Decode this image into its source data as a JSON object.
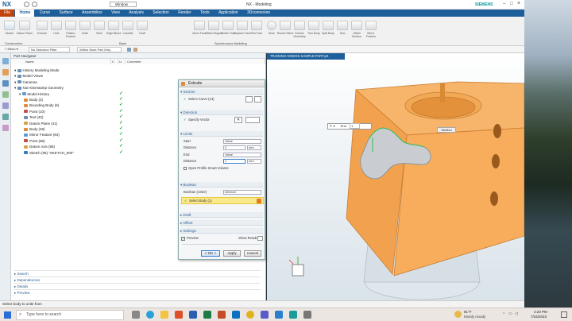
{
  "app": {
    "logo": "NX",
    "window_menu": "Window",
    "title": "NX - Modeling",
    "brand": "SIEMENS",
    "search_placeholder": "Search"
  },
  "ribbon": {
    "tabs": [
      "File",
      "Home",
      "Curve",
      "Surface",
      "Assemblies",
      "View",
      "Analysis",
      "Selection",
      "Render",
      "Tools",
      "Application",
      "3Dconnexion"
    ],
    "active_tab": "Home",
    "groups": {
      "construction": "Construction",
      "base": "Base",
      "synchronous": "Synchronous Modeling"
    },
    "more_label": "More",
    "buttons": [
      "Sketch",
      "Datum Plane",
      "Extrude",
      "Hole",
      "Pattern Feature",
      "Unite",
      "Shell",
      "Edge Blend",
      "Chamfer",
      "Draft",
      "Move Face",
      "Offset Region",
      "Delete Face",
      "Replace Face",
      "Pull Face",
      "Resize Blend",
      "Extract Geometry",
      "Trim Body",
      "Split Body",
      "Sew",
      "Offset Surface",
      "Mirror Feature"
    ]
  },
  "toolbar": {
    "menu_label": "Menu",
    "filter_value": "No Selection Filter",
    "scope_value": "Within Work Part Only"
  },
  "navigator": {
    "title": "Part Navigator",
    "columns": [
      "Name",
      "C.",
      "U.",
      "Comment"
    ],
    "rows": [
      {
        "label": "History Modeling Mode",
        "level": 0,
        "color": "#6a8fb5",
        "check": false
      },
      {
        "label": "Model Views",
        "level": 0,
        "color": "#6a8fb5",
        "check": false
      },
      {
        "label": "Cameras",
        "level": 0,
        "color": "#6a8fb5",
        "check": false
      },
      {
        "label": "Non-timestamp Geometry",
        "level": 0,
        "color": "#6a8fb5",
        "check": false
      },
      {
        "label": "Model History",
        "level": 1,
        "color": "#5c9bd5",
        "check": true
      },
      {
        "label": "Body (2)",
        "level": 2,
        "color": "#e08a3c",
        "check": true
      },
      {
        "label": "Bounding Body (6)",
        "level": 2,
        "color": "#e08a3c",
        "check": true
      },
      {
        "label": "Point (10)",
        "level": 2,
        "color": "#c24d4d",
        "check": true
      },
      {
        "label": "Text (40)",
        "level": 2,
        "color": "#6a8fb5",
        "check": true
      },
      {
        "label": "Datum Plane (41)",
        "level": 2,
        "color": "#d9a24a",
        "check": true
      },
      {
        "label": "Body (48)",
        "level": 2,
        "color": "#e08a3c",
        "check": true
      },
      {
        "label": "Mirror Feature (84)",
        "level": 2,
        "color": "#5c9bd5",
        "check": true
      },
      {
        "label": "Point (85)",
        "level": 2,
        "color": "#c24d4d",
        "check": true
      },
      {
        "label": "Datum Axis (86)",
        "level": 2,
        "color": "#d9a24a",
        "check": true
      },
      {
        "label": "Sketch (99) \"SKETCH_000\"",
        "level": 2,
        "color": "#3d7ab8",
        "check": true
      }
    ],
    "sections": [
      "Search",
      "Dependencies",
      "Details",
      "Preview"
    ]
  },
  "graphics": {
    "tab_label": "TRAINING-VIDEOS-SAMPLE-PART.prt",
    "onscreen_label": "Section",
    "end_label": "End",
    "end_value": "1"
  },
  "dialog": {
    "title": "Extrude",
    "sections": {
      "section": "Section",
      "direction": "Direction",
      "limits": "Limits",
      "boolean": "Boolean",
      "draft": "Draft",
      "offset": "Offset",
      "settings": "Settings"
    },
    "select_curve": "Select Curve (13)",
    "specify_vector": "Specify Vector",
    "start_label": "Start",
    "start_value": "Value",
    "distance_label": "Distance",
    "distance_value": "0",
    "distance_unit": "mm",
    "end_label": "End",
    "end_value": "Value",
    "distance2_label": "Distance",
    "distance2_value": "1",
    "distance2_unit": "mm",
    "open_profile": "Open Profile Smart Volume",
    "boolean_label": "Boolean (Unite)",
    "boolean_value": "Inferred",
    "select_body": "Select Body (1)",
    "preview_label": "Preview",
    "show_result": "Show Result",
    "ok": "< OK >",
    "apply": "Apply",
    "cancel": "Cancel"
  },
  "status": {
    "message": "Select body to unite from"
  },
  "taskbar": {
    "search_placeholder": "Type here to search",
    "weather_temp": "81°F",
    "weather_text": "Mostly cloudy",
    "time": "4:20 PM",
    "date": "7/24/2023"
  },
  "colors": {
    "ribbon_blue": "#1d5f9a",
    "part_orange": "#f4a04a",
    "check_green": "#1aa33a",
    "dialog_section_blue": "#2a5e91"
  }
}
